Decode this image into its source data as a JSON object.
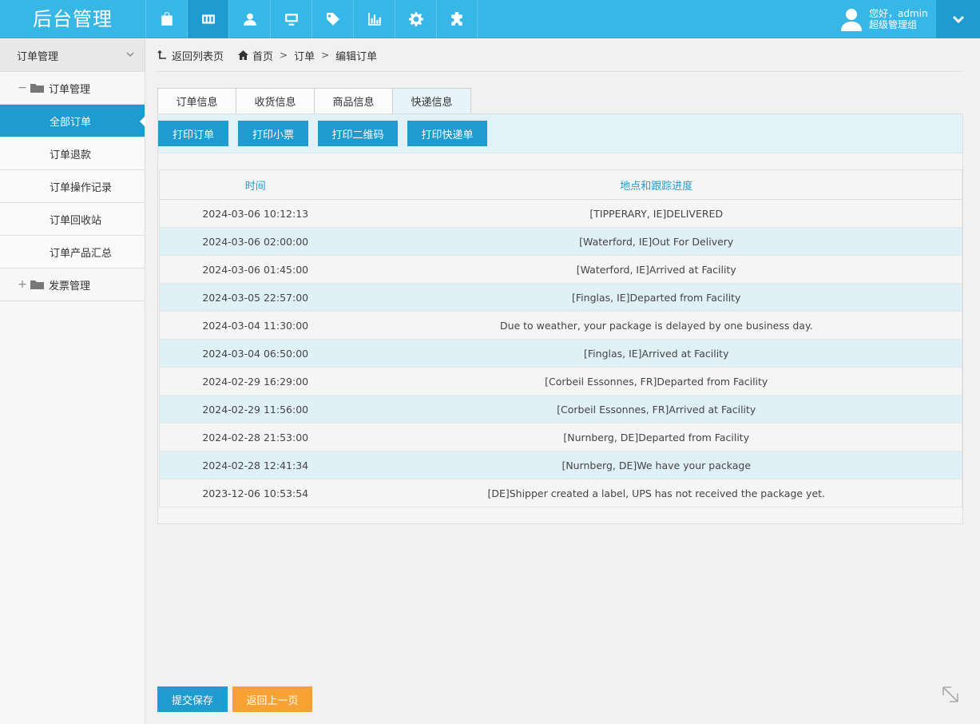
{
  "brand": {
    "title": "后台管理"
  },
  "nav": {
    "items": [
      {
        "icon": "bag-icon"
      },
      {
        "icon": "orders-icon"
      },
      {
        "icon": "user-icon"
      },
      {
        "icon": "monitor-icon"
      },
      {
        "icon": "tag-icon"
      },
      {
        "icon": "bar-chart-icon"
      },
      {
        "icon": "gear-icon"
      },
      {
        "icon": "puzzle-icon"
      }
    ],
    "active_index": 1
  },
  "user": {
    "greeting": "您好，admin",
    "role": "超级管理组"
  },
  "sidebar": {
    "header": "订单管理",
    "group1": "订单管理",
    "items": [
      "全部订单",
      "订单退款",
      "订单操作记录",
      "订单回收站",
      "订单产品汇总"
    ],
    "group2": "发票管理"
  },
  "breadcrumb": {
    "back": "返回列表页",
    "home": "首页",
    "crumb1": "订单",
    "crumb2": "编辑订单"
  },
  "tabs": [
    "订单信息",
    "收货信息",
    "商品信息",
    "快递信息"
  ],
  "toolbar": {
    "print_order": "打印订单",
    "print_receipt": "打印小票",
    "print_qr": "打印二维码",
    "print_express": "打印快递单"
  },
  "tracking": {
    "headers": {
      "time": "时间",
      "location": "地点和跟踪进度"
    },
    "rows": [
      {
        "time": "2024-03-06 10:12:13",
        "event": "[TIPPERARY, IE]DELIVERED"
      },
      {
        "time": "2024-03-06 02:00:00",
        "event": "[Waterford, IE]Out For Delivery"
      },
      {
        "time": "2024-03-06 01:45:00",
        "event": "[Waterford, IE]Arrived at Facility"
      },
      {
        "time": "2024-03-05 22:57:00",
        "event": "[Finglas, IE]Departed from Facility"
      },
      {
        "time": "2024-03-04 11:30:00",
        "event": "Due to weather, your package is delayed by one business day."
      },
      {
        "time": "2024-03-04 06:50:00",
        "event": "[Finglas, IE]Arrived at Facility"
      },
      {
        "time": "2024-02-29 16:29:00",
        "event": "[Corbeil Essonnes, FR]Departed from Facility"
      },
      {
        "time": "2024-02-29 11:56:00",
        "event": "[Corbeil Essonnes, FR]Arrived at Facility"
      },
      {
        "time": "2024-02-28 21:53:00",
        "event": "[Nurnberg, DE]Departed from Facility"
      },
      {
        "time": "2024-02-28 12:41:34",
        "event": "[Nurnberg, DE]We have your package"
      },
      {
        "time": "2023-12-06 10:53:54",
        "event": "[DE]Shipper created a label, UPS has not received the package yet."
      }
    ]
  },
  "footer": {
    "save": "提交保存",
    "back": "返回上一页"
  },
  "colors": {
    "primary": "#1e9bcf",
    "topbar": "#36b7e6",
    "warning": "#f7a233",
    "row_alt": "#e0f0f7"
  }
}
